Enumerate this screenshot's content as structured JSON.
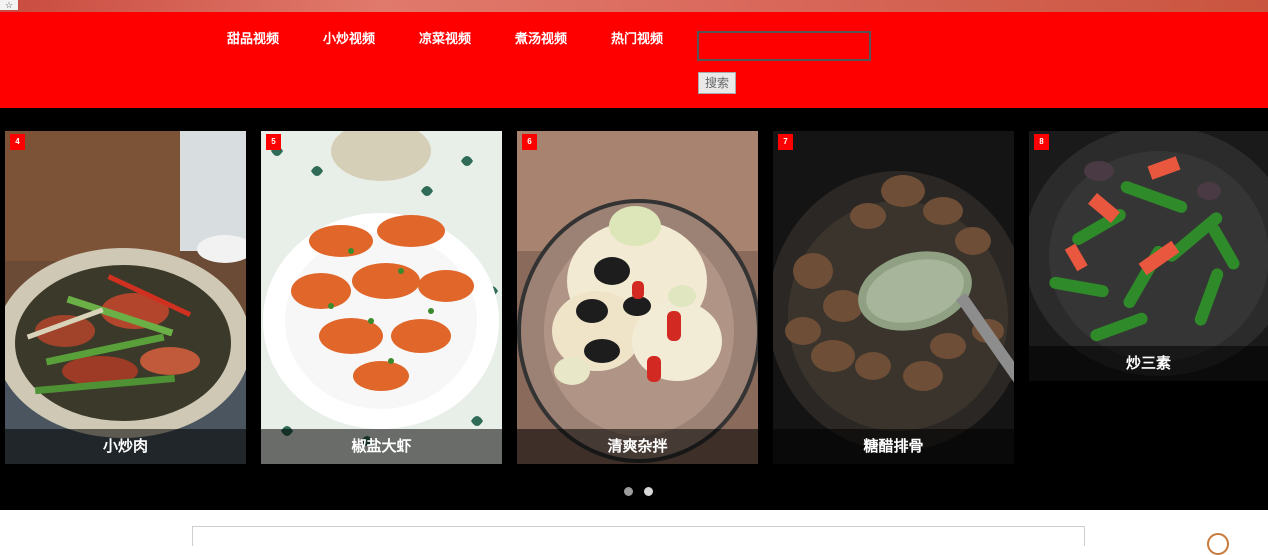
{
  "nav": {
    "items": [
      {
        "label": "甜品视频"
      },
      {
        "label": "小炒视频"
      },
      {
        "label": "凉菜视频"
      },
      {
        "label": "煮汤视频"
      },
      {
        "label": "热门视频"
      }
    ],
    "search_value": "",
    "search_button": "搜索"
  },
  "carousel": {
    "cards": [
      {
        "number": "4",
        "title": "小炒肉"
      },
      {
        "number": "5",
        "title": "椒盐大虾"
      },
      {
        "number": "6",
        "title": "清爽杂拌"
      },
      {
        "number": "7",
        "title": "糖醋排骨"
      },
      {
        "number": "8",
        "title": "炒三素"
      }
    ],
    "active_dot": 2
  },
  "colors": {
    "navbar": "#ff0000",
    "carousel_bg": "#000000",
    "badge": "#ff0000"
  }
}
